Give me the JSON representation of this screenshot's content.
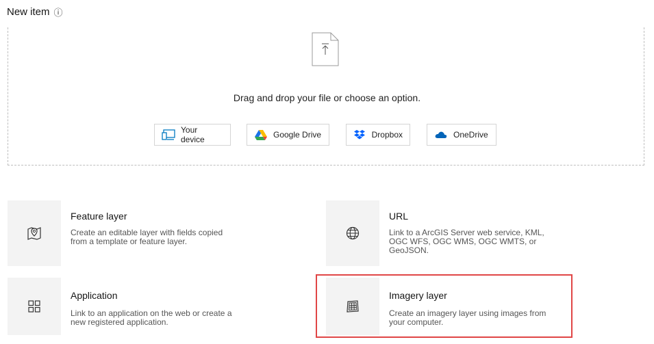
{
  "header": {
    "title": "New item",
    "info_icon": "info-icon"
  },
  "dropzone": {
    "text": "Drag and drop your file or choose an option.",
    "file_icon": "upload-file-icon",
    "sources": [
      {
        "label": "Your device",
        "icon": "device-icon"
      },
      {
        "label": "Google Drive",
        "icon": "google-drive-icon"
      },
      {
        "label": "Dropbox",
        "icon": "dropbox-icon"
      },
      {
        "label": "OneDrive",
        "icon": "onedrive-icon"
      }
    ]
  },
  "items": [
    {
      "title": "Feature layer",
      "desc_lines": [
        "Create an editable layer with fields copied",
        "from a template or feature layer."
      ],
      "icon": "map-pin-icon"
    },
    {
      "title": "URL",
      "desc_lines": [
        "Link to a ArcGIS Server web service, KML,",
        "OGC WFS, OGC WMS, OGC WMTS, or",
        "GeoJSON."
      ],
      "icon": "globe-icon"
    },
    {
      "title": "Application",
      "desc_lines": [
        "Link to an application on the web or create a",
        "new registered application."
      ],
      "icon": "grid-icon"
    },
    {
      "title": "Imagery layer",
      "desc_lines": [
        "Create an imagery layer using images from",
        "your computer."
      ],
      "icon": "imagery-icon"
    }
  ],
  "colors": {
    "highlight": "#e04545",
    "tile": "#f3f3f3",
    "dropbox": "#0061fe",
    "onedrive": "#0364b8"
  }
}
